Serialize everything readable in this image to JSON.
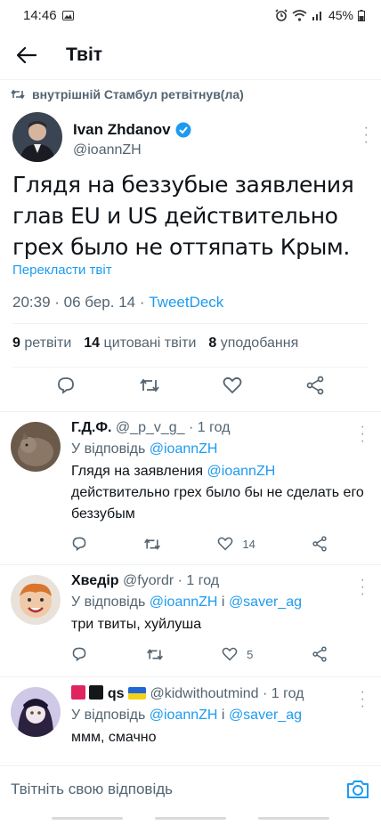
{
  "status_bar": {
    "time": "14:46",
    "battery": "45%"
  },
  "header": {
    "title": "Твіт"
  },
  "retweet_line": {
    "text": "внутрішній Стамбул ретвітнув(ла)"
  },
  "tweet": {
    "author_name": "Ivan Zhdanov",
    "author_handle": "@ioannZH",
    "text": "Глядя на беззубые заявления глав EU и US действительно грех было не оттяпать Крым.",
    "translate_label": "Перекласти твіт",
    "time": "20:39",
    "date": "06 бер. 14",
    "source": "TweetDeck",
    "stats": {
      "retweets_count": "9",
      "retweets_label": "ретвіти",
      "quotes_count": "14",
      "quotes_label": "цитовані твіти",
      "likes_count": "8",
      "likes_label": "уподобання"
    }
  },
  "replies": [
    {
      "name": "Г.Д.Ф.",
      "handle": "@_p_v_g_",
      "age": "1 год",
      "reply_to_prefix": "У відповідь",
      "reply_to": "@ioannZH",
      "text_mention": "@ioannZH",
      "text_before": "Глядя на заявления",
      "text_after": "действительно грех было бы не сделать его беззубым",
      "likes": "14"
    },
    {
      "name": "Хведір",
      "handle": "@fyordr",
      "age": "1 год",
      "reply_to_prefix": "У відповідь",
      "reply_to": "@ioannZH",
      "reply_and": "і",
      "reply_to_2": "@saver_ag",
      "text": "три твиты, хуйлуша",
      "likes": "5"
    },
    {
      "name": "qs",
      "handle": "@kidwithoutmind",
      "age": "1 год",
      "reply_to_prefix": "У відповідь",
      "reply_to": "@ioannZH",
      "reply_and": "і",
      "reply_to_2": "@saver_ag",
      "text": "ммм, смачно"
    }
  ],
  "compose": {
    "placeholder": "Твітніть свою відповідь"
  },
  "colors": {
    "accent": "#1d9bf0",
    "muted": "#536471",
    "text": "#0f1419"
  }
}
